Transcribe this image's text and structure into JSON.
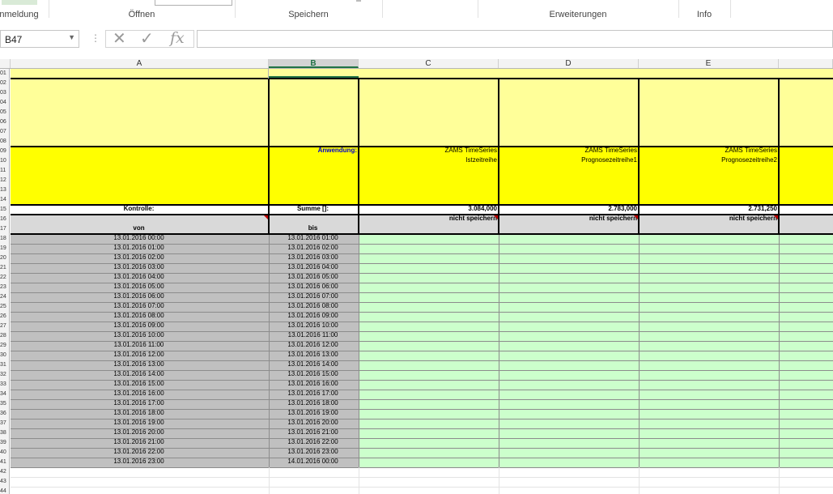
{
  "ribbon": {
    "groups": [
      "Anmeldung",
      "Öffnen",
      "Speichern",
      "Erweiterungen",
      "Info"
    ]
  },
  "formula_bar": {
    "name_box": "B47",
    "dots": "⋮",
    "cancel_glyph": "✕",
    "enter_glyph": "✓",
    "fx_glyph": "fx",
    "formula": ""
  },
  "columns": [
    "A",
    "B",
    "C",
    "D",
    "E"
  ],
  "selected_column": "B",
  "header_rows": {
    "anwendung_label": "Anwendung:",
    "series": [
      {
        "line1": "ZAMS TimeSeries",
        "line2": "Istzeitreihe",
        "summe": "3.084,000",
        "status": "nicht speichern"
      },
      {
        "line1": "ZAMS TimeSeries",
        "line2": "Prognosezeitreihe1",
        "summe": "2.783,000",
        "status": "nicht speichern"
      },
      {
        "line1": "ZAMS TimeSeries",
        "line2": "Prognosezeitreihe2",
        "summe": "2.731,250",
        "status": "nicht speichern"
      }
    ],
    "kontrolle_label": "Kontrolle:",
    "summe_label": "Summe []:",
    "von_label": "von",
    "bis_label": "bis"
  },
  "time_rows": [
    {
      "von": "13.01.2016 00:00",
      "bis": "13.01.2016 01:00"
    },
    {
      "von": "13.01.2016 01:00",
      "bis": "13.01.2016 02:00"
    },
    {
      "von": "13.01.2016 02:00",
      "bis": "13.01.2016 03:00"
    },
    {
      "von": "13.01.2016 03:00",
      "bis": "13.01.2016 04:00"
    },
    {
      "von": "13.01.2016 04:00",
      "bis": "13.01.2016 05:00"
    },
    {
      "von": "13.01.2016 05:00",
      "bis": "13.01.2016 06:00"
    },
    {
      "von": "13.01.2016 06:00",
      "bis": "13.01.2016 07:00"
    },
    {
      "von": "13.01.2016 07:00",
      "bis": "13.01.2016 08:00"
    },
    {
      "von": "13.01.2016 08:00",
      "bis": "13.01.2016 09:00"
    },
    {
      "von": "13.01.2016 09:00",
      "bis": "13.01.2016 10:00"
    },
    {
      "von": "13.01.2016 10:00",
      "bis": "13.01.2016 11:00"
    },
    {
      "von": "13.01.2016 11:00",
      "bis": "13.01.2016 12:00"
    },
    {
      "von": "13.01.2016 12:00",
      "bis": "13.01.2016 13:00"
    },
    {
      "von": "13.01.2016 13:00",
      "bis": "13.01.2016 14:00"
    },
    {
      "von": "13.01.2016 14:00",
      "bis": "13.01.2016 15:00"
    },
    {
      "von": "13.01.2016 15:00",
      "bis": "13.01.2016 16:00"
    },
    {
      "von": "13.01.2016 16:00",
      "bis": "13.01.2016 17:00"
    },
    {
      "von": "13.01.2016 17:00",
      "bis": "13.01.2016 18:00"
    },
    {
      "von": "13.01.2016 18:00",
      "bis": "13.01.2016 19:00"
    },
    {
      "von": "13.01.2016 19:00",
      "bis": "13.01.2016 20:00"
    },
    {
      "von": "13.01.2016 20:00",
      "bis": "13.01.2016 21:00"
    },
    {
      "von": "13.01.2016 21:00",
      "bis": "13.01.2016 22:00"
    },
    {
      "von": "13.01.2016 22:00",
      "bis": "13.01.2016 23:00"
    },
    {
      "von": "13.01.2016 23:00",
      "bis": "14.01.2016 00:00"
    }
  ],
  "colors": {
    "pale_yellow": "#ffff99",
    "yellow": "#ffff00",
    "gray": "#c0c0c0",
    "light_gray": "#d9d9d9",
    "pale_green": "#ccffcc",
    "blue_text": "#0000cc",
    "selection_green": "#217346"
  },
  "icons": [
    "dropdown-arrow-icon",
    "cancel-icon",
    "enter-icon",
    "function-icon",
    "comment-indicator-icon"
  ]
}
